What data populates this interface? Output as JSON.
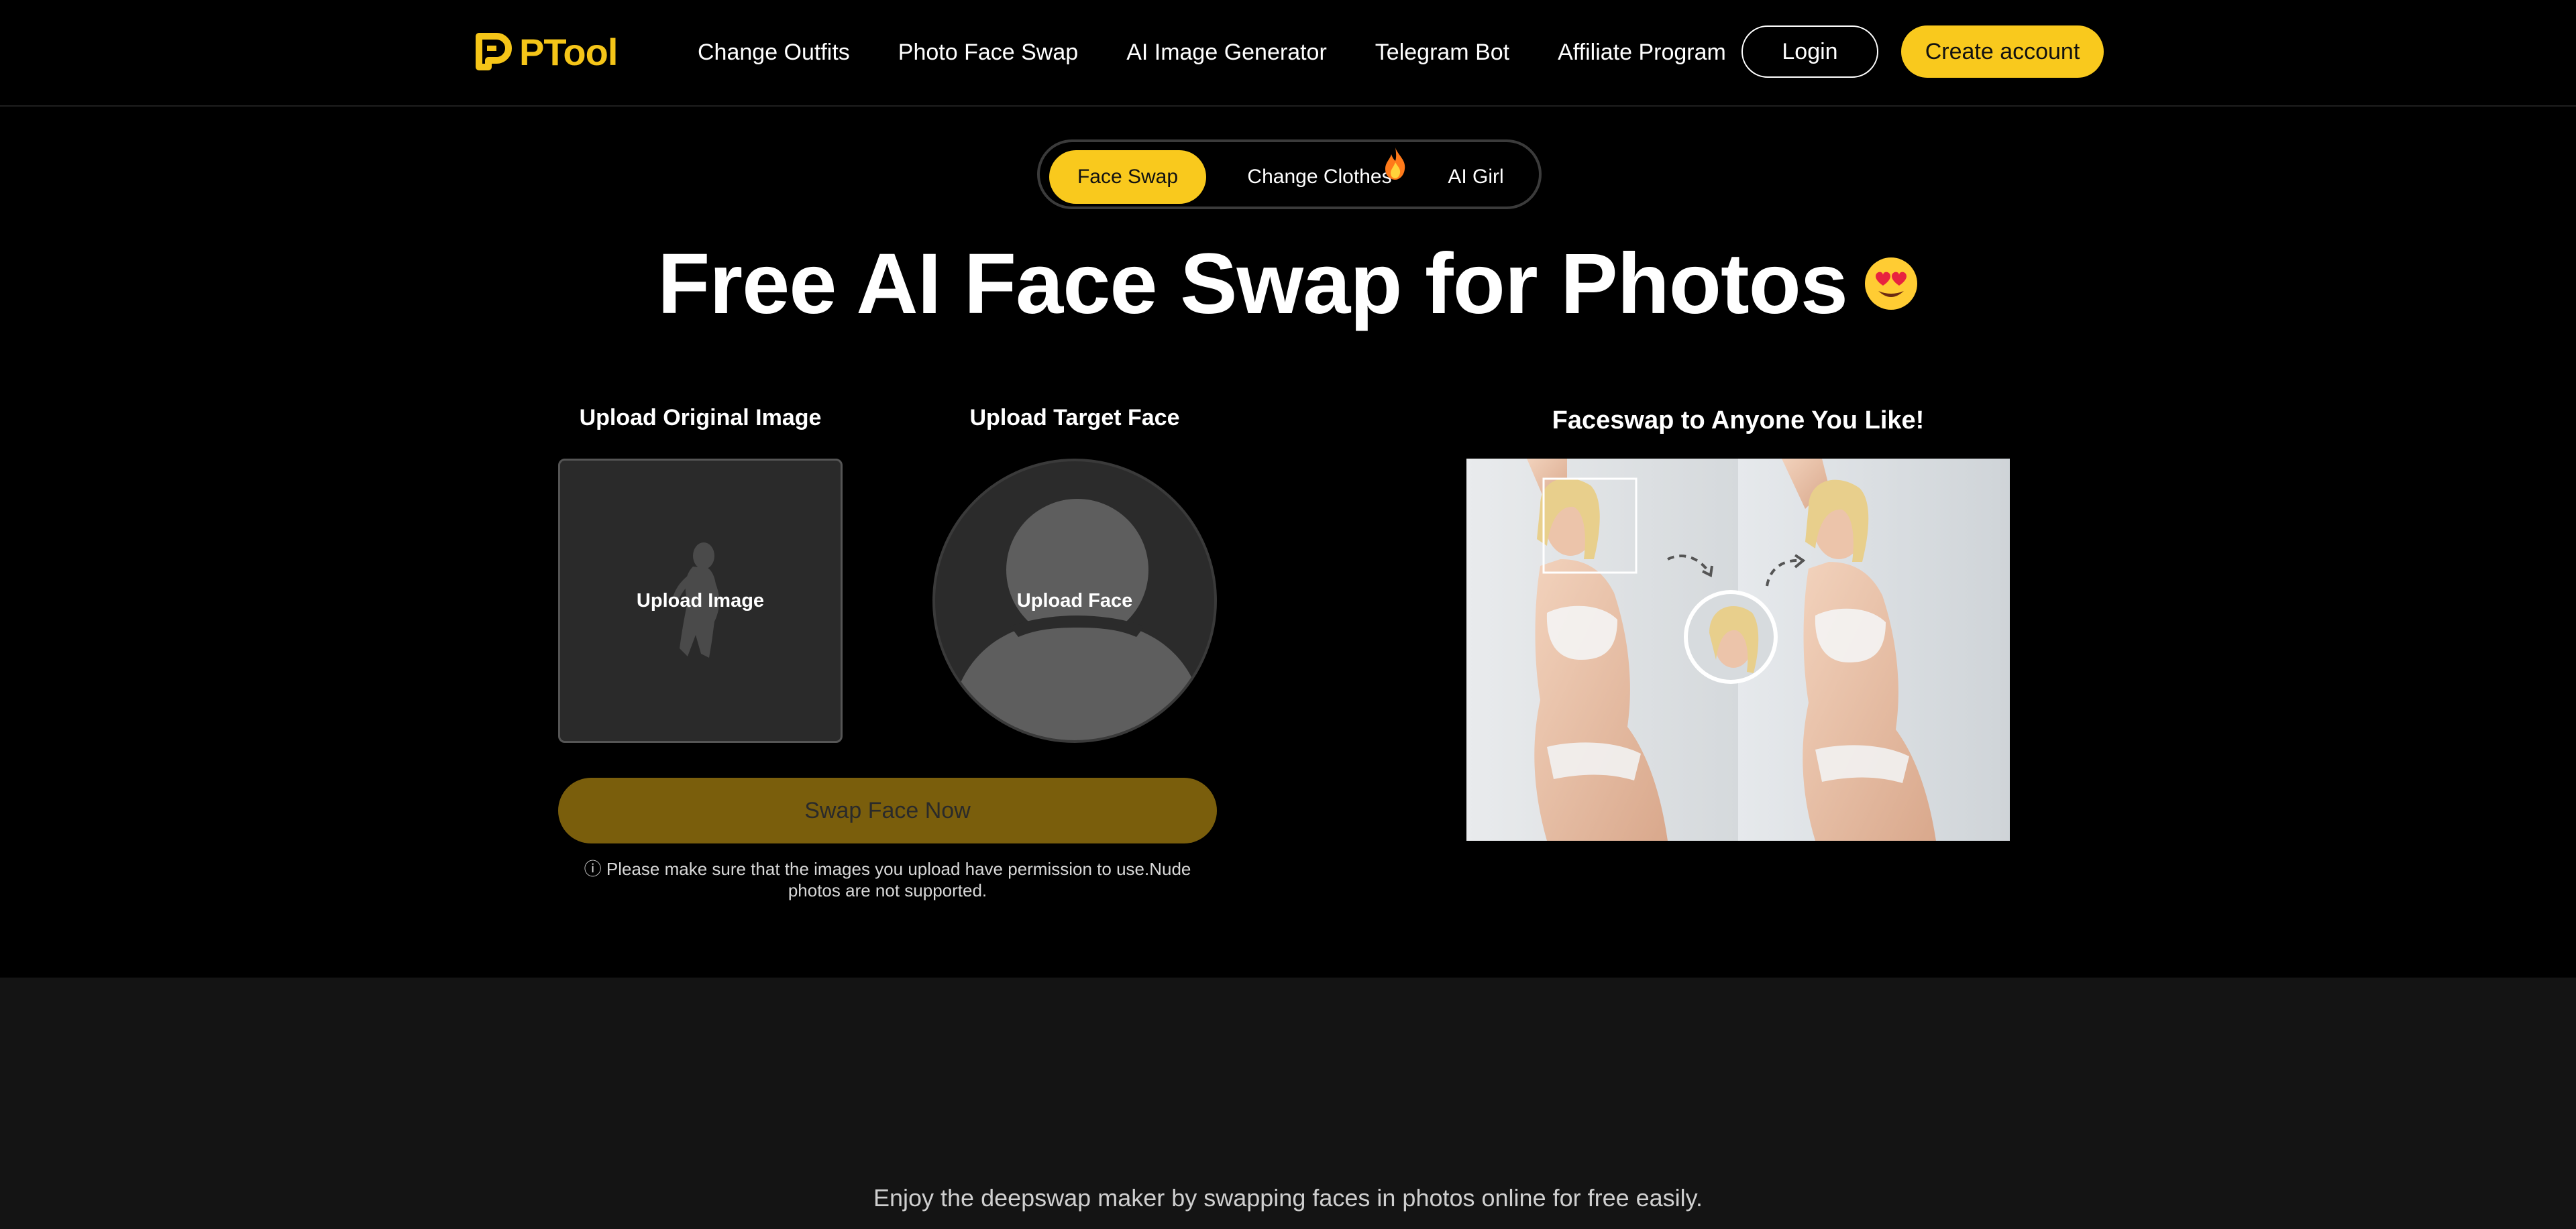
{
  "brand": {
    "name": "PTool",
    "accent": "#f9c91d"
  },
  "nav": {
    "items": [
      {
        "label": "Change Outfits"
      },
      {
        "label": "Photo Face Swap"
      },
      {
        "label": "AI Image Generator"
      },
      {
        "label": "Telegram Bot"
      },
      {
        "label": "Affiliate Program"
      }
    ],
    "login_label": "Login",
    "create_label": "Create account"
  },
  "tabs": {
    "items": [
      {
        "label": "Face Swap",
        "active": true
      },
      {
        "label": "Change Clothes",
        "badge_icon": "fire-icon"
      },
      {
        "label": "AI Girl"
      }
    ]
  },
  "hero": {
    "title": "Free AI Face Swap for Photos",
    "emoji_icon": "heart-eyes-emoji-icon"
  },
  "upload": {
    "original_label": "Upload Original Image",
    "original_button": "Upload Image",
    "target_label": "Upload Target Face",
    "target_button": "Upload Face",
    "swap_button": "Swap Face Now",
    "notice_icon": "ⓘ",
    "notice": "Please make sure that the images you upload have permission to use.Nude photos are not supported."
  },
  "example": {
    "title": "Faceswap to Anyone You Like!"
  },
  "lower": {
    "text": "Enjoy the deepswap maker by swapping faces in photos online for free easily."
  }
}
